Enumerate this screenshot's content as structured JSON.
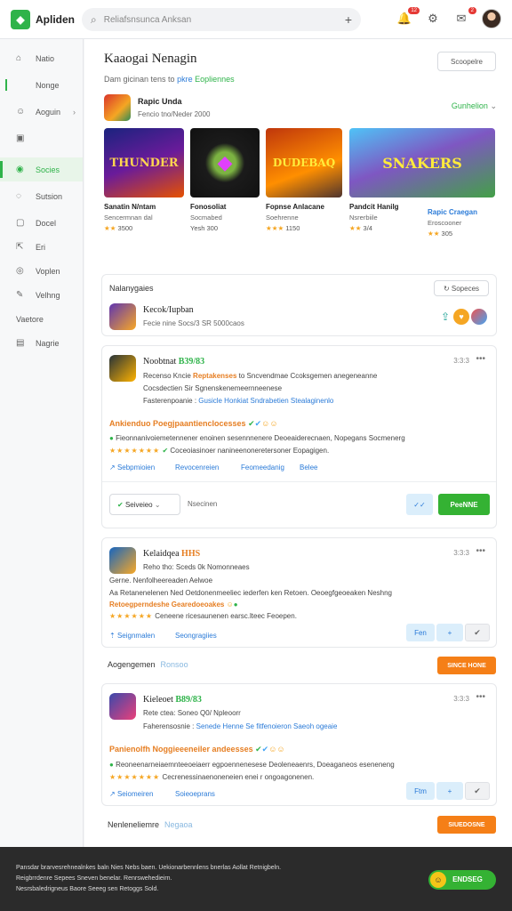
{
  "header": {
    "logo_text": "Apliden",
    "search_placeholder": "Reliafsnsunca Anksan",
    "notifications_badge": "12",
    "messages_badge": "2"
  },
  "sidebar": {
    "items": [
      {
        "label": "Natio",
        "icon": "home-icon"
      },
      {
        "label": "Nonge",
        "icon": "bookmark-icon"
      },
      {
        "label": "Aoguin",
        "icon": "user-icon"
      },
      {
        "label": "",
        "icon": "image-icon"
      },
      {
        "label": "Socies",
        "icon": "games-icon"
      },
      {
        "label": "Sutsion",
        "icon": "chat-icon"
      },
      {
        "label": "Docel",
        "icon": "doc-icon"
      },
      {
        "label": "Eri",
        "icon": "share-icon"
      },
      {
        "label": "Voplen",
        "icon": "settings-icon"
      },
      {
        "label": "Velhng",
        "icon": "edit-icon"
      },
      {
        "label": "Vaetore",
        "icon": ""
      },
      {
        "label": "Nagrie",
        "icon": "chart-icon"
      }
    ]
  },
  "main": {
    "title": "Kaaogai Nenagin",
    "top_button": "Scoopelre",
    "subtitle_plain": "Dam gicinan tens to",
    "subtitle_links": [
      "pkre",
      "Eopliennes"
    ],
    "featured": {
      "name": "Rapic Unda",
      "meta": "Fencio tno/Neder 2000",
      "right_label": "Gunhelion"
    },
    "games": [
      {
        "art": "THUNDER",
        "name": "Sanatin N/ntam",
        "sub": "Sencermnan dal",
        "rating": "3500"
      },
      {
        "art": "",
        "name": "Fonosoliat",
        "sub": "Socmabed",
        "rating": "Yesh 300"
      },
      {
        "art": "DUDEBAQ",
        "name": "Fopnse Anlacane",
        "sub": "Soehrenne",
        "rating": "1150"
      },
      {
        "art": "SNAKERS",
        "name": "Pandcit Hanilg",
        "sub": "Nsrerbiile",
        "rating": "3/4"
      },
      {
        "art": "",
        "name": "Rapic Craegan",
        "sub": "Eroscooner",
        "rating": "305"
      }
    ],
    "section1": {
      "title": "Nalanygaies",
      "button": "Sopeces",
      "item_title": "Kecok/Iupban",
      "item_sub": "Fecie nine Socs/3 SR 5000caos"
    },
    "post1": {
      "author": "Noobtnat",
      "tag": "B39/83",
      "time": "3:3:3",
      "line1_a": "Recenso Kncie",
      "line1_b": "Reptakenses",
      "line1_c": "to Sncvendmae Ccoksgemen anegeneanne",
      "line2": "Cocsdectien Sir Sgnenskenemeernneenese",
      "line3_a": "Fasterenpoanie :",
      "line3_b": "Gusicle Honkiat Sndrabetien Stealaginenlo",
      "hl_a": "Ankienduo",
      "hl_b": "Poegjpaantienclocesses",
      "line4": "Fieonnanivoiemetennener enoinen sesennnenere Deoeaiderecnaen, Nopegans Socmenerg",
      "line5": "Coceoiasinoer nanineenoneretersoner Eopagigen.",
      "links": [
        "Sebpmioien",
        "Revocenreien",
        "Feomeedanig",
        "Belee"
      ],
      "reply_placeholder": "Seiveieo",
      "reply_label": "Nsecinen",
      "primary_btn": "PeeNNE"
    },
    "post2": {
      "author": "Kelaidqea",
      "tag": "HHS",
      "time": "3:3:3",
      "line1": "Reho tho: Sceds 0k Nomonneaes",
      "line2": "Gerne. Nenfolheereaden Aelwoe",
      "line3": "Aa Retanenelenen Ned Oetdonenmeeliec iederfen ken  Retoen. Oeoegfgeoeaken Neshng",
      "hl": "Retoegperndeshe Gearedoeoakes",
      "line4": "Ceneene ricesaunenen earsc.lteec Feoepen.",
      "links": [
        "Seignmalen",
        "Seongragiies"
      ],
      "btn_light": "Fen"
    },
    "label1": {
      "text": "Aogengemen",
      "tag": "Ronsoo",
      "button": "SINCE HONE"
    },
    "post3": {
      "author": "Kieleoet",
      "tag": "B89/83",
      "time": "3:3:3",
      "line1": "Rete ctea: Soneo Q0/ Npleoorr",
      "line2_a": "Faherensosnie :",
      "line2_b": "Senede Henne Se fitfenoieron Saeoh ogeaie",
      "hl_a": "Panienolfh",
      "hl_b": "Noggieeeneiler andeesses",
      "line3": "Reoneenarneiaemnteeoeiaerr egpoennenesese Deoleneaenrs, Doeaganeos eseneneng",
      "line4": "Cecrenessinaenoneneien enei r ongoagonenen.",
      "links": [
        "Seiomeiren",
        "Soieoeprans"
      ],
      "btn_light": "Ftm"
    },
    "label2": {
      "text": "Nenleneliemre",
      "tag": "Negaoa",
      "button": "SIUEDOSNE"
    }
  },
  "footer": {
    "lines": [
      "Pansdar brarvesrehnealnkes baln Nies Nebs baen. Uekionarbennlens bnerlas Aollat Retnigbeln.",
      "Reigbrrdenre Sepees Sneven benelar. Renrswehedieirn.",
      "Nesrsbaledrigneus Baore Seeeg sen Retoggs Sold."
    ],
    "button": "ENDSEG"
  },
  "colors": {
    "accent": "#2fb34a",
    "orange": "#f57f17",
    "link": "#2b7bd8"
  }
}
